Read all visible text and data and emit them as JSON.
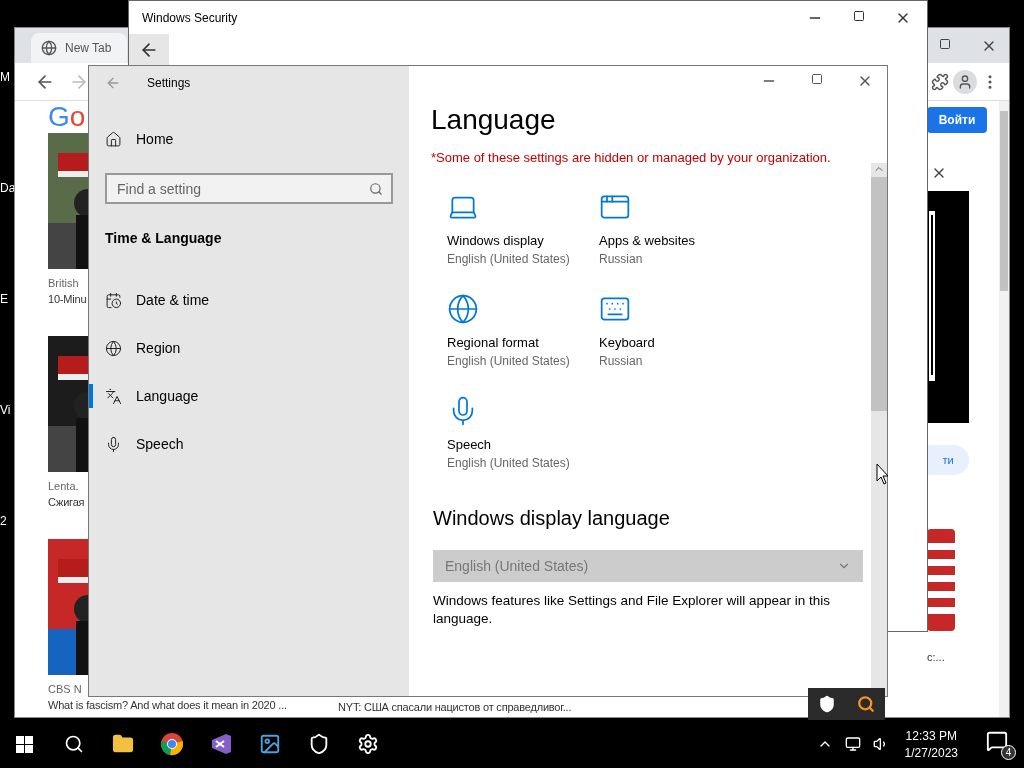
{
  "desktop_icons": [
    {
      "label": "M"
    },
    {
      "label": "Da"
    },
    {
      "label": "E"
    },
    {
      "label": "Vi"
    },
    {
      "label": "2"
    }
  ],
  "browser": {
    "tab_title": "New Tab",
    "logo": [
      {
        "text": "G",
        "color": "#4285f4"
      },
      {
        "text": "o",
        "color": "#ea4335"
      }
    ],
    "sign_in": "Войти",
    "cards": [
      {
        "source": "British",
        "title": "10-Minu"
      },
      {
        "source": "Lenta.",
        "title": "Сжигая"
      },
      {
        "source": "CBS N",
        "title": "What is fascism? And what does it mean in 2020 ..."
      }
    ],
    "second_title": "NYT: США спасали нацистов от справедливог...",
    "side_button": "ти",
    "side_caption": "с:..."
  },
  "security": {
    "title": "Windows Security"
  },
  "settings": {
    "title": "Settings",
    "home": "Home",
    "search_placeholder": "Find a setting",
    "section": "Time & Language",
    "nav": [
      {
        "label": "Date & time",
        "kind": "calendar",
        "selected": false
      },
      {
        "label": "Region",
        "kind": "globe",
        "selected": false
      },
      {
        "label": "Language",
        "kind": "language",
        "selected": true
      },
      {
        "label": "Speech",
        "kind": "mic",
        "selected": false
      }
    ],
    "heading": "Language",
    "notice": "*Some of these settings are hidden or managed by your organization.",
    "tiles": [
      {
        "kind": "laptop",
        "name": "Windows display",
        "value": "English (United States)"
      },
      {
        "kind": "window",
        "name": "Apps & websites",
        "value": "Russian"
      },
      {
        "kind": "globe",
        "name": "Regional format",
        "value": "English (United States)"
      },
      {
        "kind": "keyboard",
        "name": "Keyboard",
        "value": "Russian"
      },
      {
        "kind": "mic",
        "name": "Speech",
        "value": "English (United States)"
      }
    ],
    "display_language": {
      "heading": "Windows display language",
      "dropdown": {
        "value": "English (United States)",
        "disabled": true
      },
      "description": "Windows features like Settings and File Explorer will appear in this language."
    }
  },
  "taskbar": {
    "time": "12:33 PM",
    "date": "1/27/2023",
    "notifications": "4"
  }
}
